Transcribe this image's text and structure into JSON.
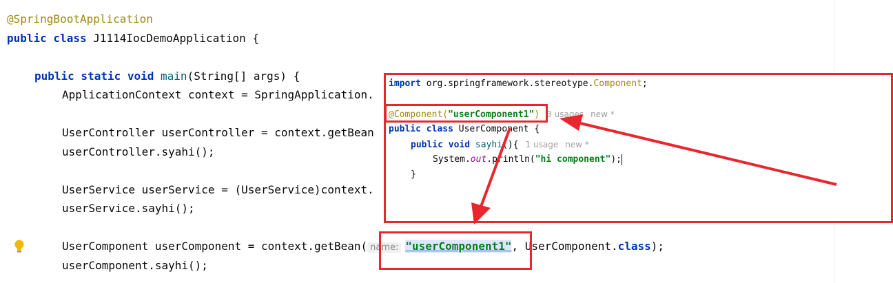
{
  "editor": {
    "line1": "@SpringBootApplication",
    "line2": {
      "kw": "public class",
      "rest": " J1114IocDemoApplication {"
    },
    "line3": {
      "kw": "public static void",
      "method": " main",
      "rest": "(String[] args) {"
    },
    "line4": "ApplicationContext context = SpringApplication.",
    "line5": "UserController userController = context.getBean",
    "line6": "userController.syahi();",
    "line7": "UserService userService = (UserService)context.",
    "line8": "userService.sayhi();",
    "line9": {
      "start": "UserComponent userComponent = context.getBean(",
      "hint": "name:",
      "arg": "\"userComponent1\"",
      "end_plain": ", UserComponent.",
      "end_kw": "class",
      "end_tail": ");"
    },
    "line10": "userComponent.sayhi();"
  },
  "popup": {
    "import_kw": "import",
    "import_pkg": " org.springframework.stereotype.",
    "import_cls": "Component",
    "import_end": ";",
    "anno_name": "@Component(",
    "anno_str": "\"userComponent1\"",
    "anno_close": ")",
    "anno_usages": "3 usages",
    "anno_new": "new *",
    "class_kw": "public class",
    "class_rest": " UserComponent {",
    "method_kw": "public void",
    "method_name": " sayhi",
    "method_rest": "(){",
    "method_usages": "1 usage",
    "method_new": "new *",
    "body_start": "System.",
    "body_field": "out",
    "body_mid": ".println(",
    "body_str": "\"hi component\"",
    "body_end": ");",
    "close_method": "}",
    "close_brace": "}"
  },
  "colors": {
    "annotation_box": "#e8262e",
    "keyword": "#0033b3",
    "string": "#067d17",
    "annotation": "#9e880d"
  },
  "icons": {
    "bulb": "lightbulb-icon"
  }
}
